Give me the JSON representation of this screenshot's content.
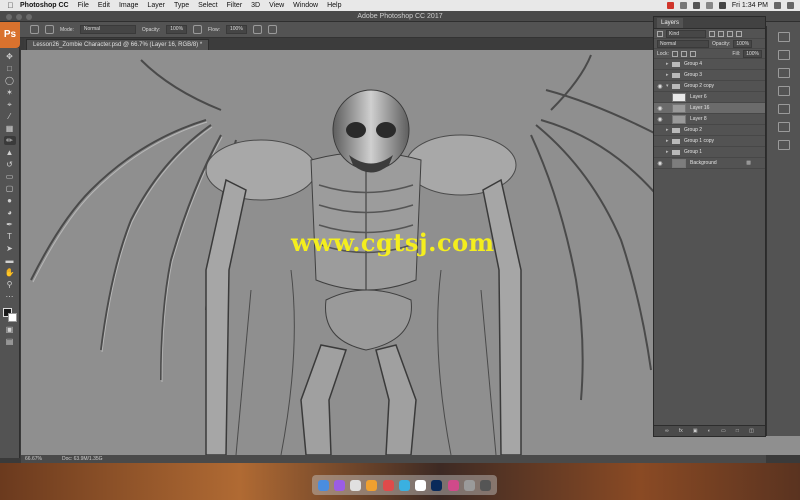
{
  "menubar": {
    "app_name": "Photoshop CC",
    "items": [
      "File",
      "Edit",
      "Image",
      "Layer",
      "Type",
      "Select",
      "Filter",
      "3D",
      "View",
      "Window",
      "Help"
    ],
    "clock": "Fri 1:34 PM"
  },
  "window": {
    "title": "Adobe Photoshop CC 2017"
  },
  "ps_logo": "Ps",
  "options_bar": {
    "mode_label": "Mode:",
    "mode_value": "Normal",
    "opacity_label": "Opacity:",
    "opacity_value": "100%",
    "flow_label": "Flow:",
    "flow_value": "100%"
  },
  "document_tab": "Lesson26_Zombie Character.psd @ 66.7% (Layer 16, RGB/8) *",
  "canvas": {
    "watermark": "www.cgtsj.com"
  },
  "status_bar": {
    "zoom": "66.67%",
    "doc_info": "Doc: 63.9M/1.35G"
  },
  "layers_panel": {
    "tab": "Layers",
    "filter_kind": "Kind",
    "blend_mode": "Normal",
    "opacity_label": "Opacity:",
    "opacity_value": "100%",
    "lock_label": "Lock:",
    "fill_label": "Fill:",
    "fill_value": "100%",
    "layers": [
      {
        "name": "Group 4",
        "type": "group",
        "visible": false,
        "selected": false
      },
      {
        "name": "Group 3",
        "type": "group",
        "visible": false,
        "selected": false
      },
      {
        "name": "Group 2 copy",
        "type": "group-open",
        "visible": true,
        "selected": false
      },
      {
        "name": "Layer 6",
        "type": "layer-white",
        "visible": false,
        "selected": false
      },
      {
        "name": "Layer 16",
        "type": "layer-img",
        "visible": true,
        "selected": true
      },
      {
        "name": "Layer 8",
        "type": "layer-img",
        "visible": true,
        "selected": false
      },
      {
        "name": "Group 2",
        "type": "group",
        "visible": false,
        "selected": false
      },
      {
        "name": "Group 1 copy",
        "type": "group",
        "visible": false,
        "selected": false
      },
      {
        "name": "Group 1",
        "type": "group",
        "visible": false,
        "selected": false
      },
      {
        "name": "Background",
        "type": "background",
        "visible": true,
        "selected": false
      }
    ],
    "footer_icons": [
      "link-icon",
      "fx-icon",
      "mask-icon",
      "adjustment-icon",
      "folder-icon",
      "new-layer-icon",
      "trash-icon"
    ]
  },
  "colors": {
    "canvas_bg": "#8f8f8f",
    "panel_bg": "#535353",
    "watermark": "#f4ee1e",
    "selected_layer": "#6b6b6b"
  }
}
